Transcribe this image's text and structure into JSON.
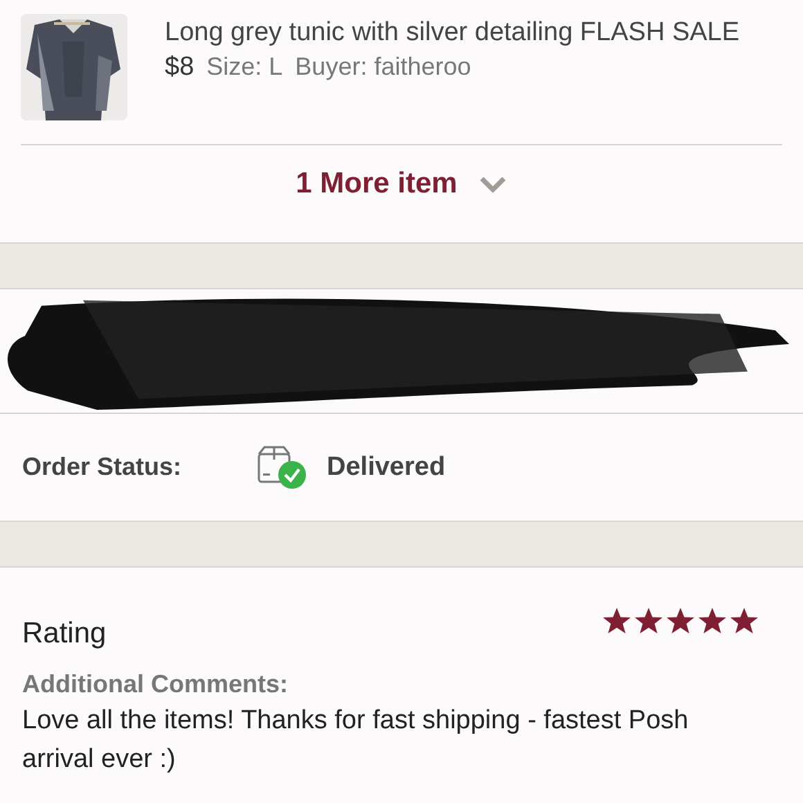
{
  "item": {
    "title": "Long grey tunic with silver detailing FLASH SALE",
    "price": "$8",
    "size": "Size: L",
    "buyer": "Buyer: faitheroo"
  },
  "more_items": {
    "label": "1 More item"
  },
  "order_status": {
    "label": "Order Status:",
    "value": "Delivered"
  },
  "rating": {
    "label": "Rating",
    "stars": 5,
    "comments_label": "Additional Comments:",
    "comment": "Love all the items! Thanks for fast shipping - fastest Posh arrival ever :)"
  }
}
